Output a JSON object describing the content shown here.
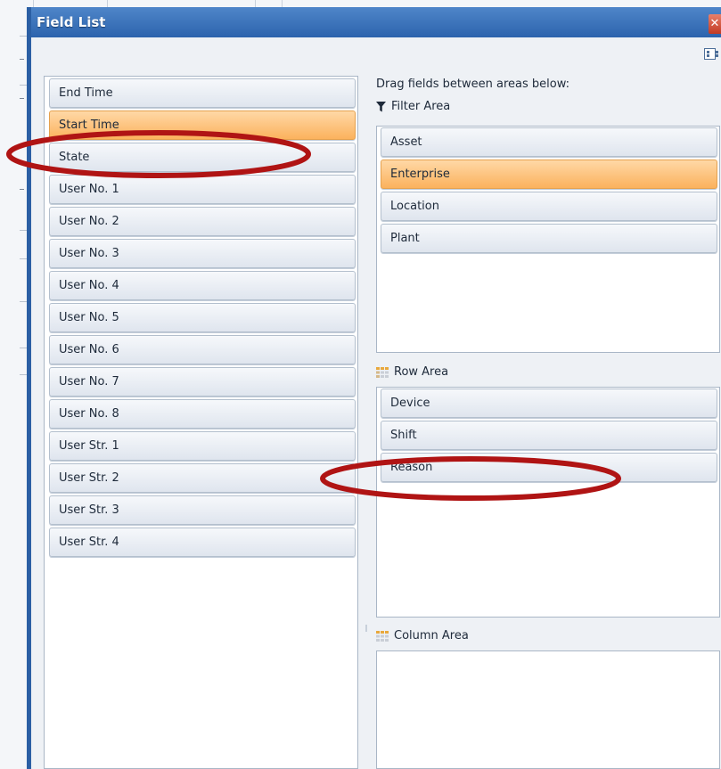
{
  "dialog": {
    "title": "Field List",
    "close_glyph": "✕",
    "hint": "Drag fields between areas below:"
  },
  "field_list": {
    "items": [
      {
        "label": "End Time",
        "selected": false
      },
      {
        "label": "Start Time",
        "selected": true
      },
      {
        "label": "State",
        "selected": false
      },
      {
        "label": "User No. 1",
        "selected": false
      },
      {
        "label": "User No. 2",
        "selected": false
      },
      {
        "label": "User No. 3",
        "selected": false
      },
      {
        "label": "User No. 4",
        "selected": false
      },
      {
        "label": "User No. 5",
        "selected": false
      },
      {
        "label": "User No. 6",
        "selected": false
      },
      {
        "label": "User No. 7",
        "selected": false
      },
      {
        "label": "User No. 8",
        "selected": false
      },
      {
        "label": "User Str. 1",
        "selected": false
      },
      {
        "label": "User Str. 2",
        "selected": false
      },
      {
        "label": "User Str. 3",
        "selected": false
      },
      {
        "label": "User Str. 4",
        "selected": false
      }
    ]
  },
  "filter_area": {
    "label": "Filter Area",
    "icon": "funnel-icon",
    "items": [
      {
        "label": "Asset",
        "selected": false
      },
      {
        "label": "Enterprise",
        "selected": true
      },
      {
        "label": "Location",
        "selected": false
      },
      {
        "label": "Plant",
        "selected": false
      }
    ]
  },
  "row_area": {
    "label": "Row Area",
    "icon": "row-grid-icon",
    "items": [
      {
        "label": "Device",
        "selected": false
      },
      {
        "label": "Shift",
        "selected": false
      },
      {
        "label": "Reason",
        "selected": false
      }
    ]
  },
  "column_area": {
    "label": "Column Area",
    "icon": "column-grid-icon",
    "items": []
  },
  "colors": {
    "title_bar": "#2c63ad",
    "selected_field": "#fbb25d",
    "annotation": "#b01414"
  }
}
